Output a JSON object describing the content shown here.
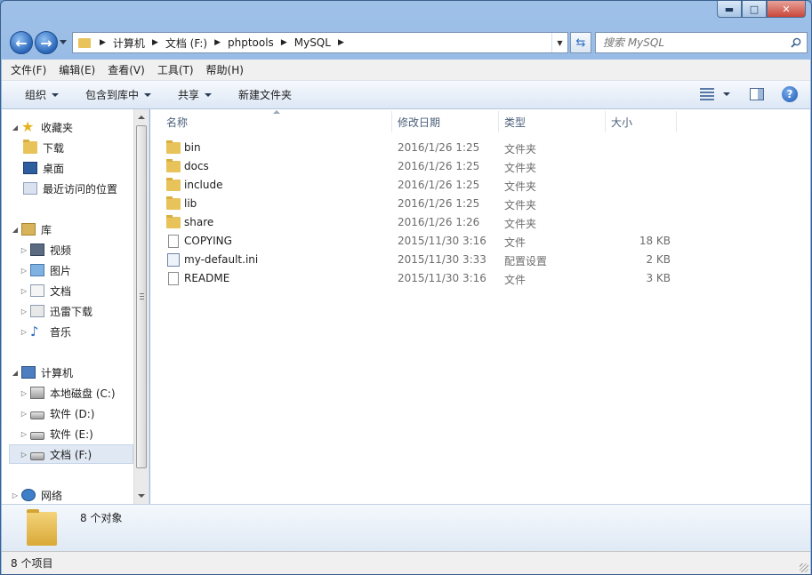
{
  "caption": {
    "minimize": "▬",
    "maximize": "□",
    "close": "✕"
  },
  "address": {
    "crumbs": [
      "计算机",
      "文档 (F:)",
      "phptools",
      "MySQL"
    ]
  },
  "search": {
    "placeholder": "搜索 MySQL"
  },
  "menu": [
    "文件(F)",
    "编辑(E)",
    "查看(V)",
    "工具(T)",
    "帮助(H)"
  ],
  "toolbar": {
    "organize": "组织",
    "include": "包含到库中",
    "share": "共享",
    "new_folder": "新建文件夹"
  },
  "nav": {
    "favorites": "收藏夹",
    "downloads": "下载",
    "desktop": "桌面",
    "recent": "最近访问的位置",
    "libraries": "库",
    "videos": "视频",
    "pictures": "图片",
    "documents": "文档",
    "thunder": "迅雷下载",
    "music": "音乐",
    "computer": "计算机",
    "drive_c": "本地磁盘 (C:)",
    "drive_d": "软件 (D:)",
    "drive_e": "软件 (E:)",
    "drive_f": "文档 (F:)",
    "network": "网络"
  },
  "columns": {
    "name": "名称",
    "date": "修改日期",
    "type": "类型",
    "size": "大小"
  },
  "files": [
    {
      "name": "bin",
      "date": "2016/1/26 1:25",
      "type": "文件夹",
      "size": "",
      "icon": "folder"
    },
    {
      "name": "docs",
      "date": "2016/1/26 1:25",
      "type": "文件夹",
      "size": "",
      "icon": "folder"
    },
    {
      "name": "include",
      "date": "2016/1/26 1:25",
      "type": "文件夹",
      "size": "",
      "icon": "folder"
    },
    {
      "name": "lib",
      "date": "2016/1/26 1:25",
      "type": "文件夹",
      "size": "",
      "icon": "folder"
    },
    {
      "name": "share",
      "date": "2016/1/26 1:26",
      "type": "文件夹",
      "size": "",
      "icon": "folder"
    },
    {
      "name": "COPYING",
      "date": "2015/11/30 3:16",
      "type": "文件",
      "size": "18 KB",
      "icon": "file"
    },
    {
      "name": "my-default.ini",
      "date": "2015/11/30 3:33",
      "type": "配置设置",
      "size": "2 KB",
      "icon": "config"
    },
    {
      "name": "README",
      "date": "2015/11/30 3:16",
      "type": "文件",
      "size": "3 KB",
      "icon": "file"
    }
  ],
  "details": {
    "count": "8 个对象"
  },
  "status": {
    "items": "8 个项目"
  }
}
